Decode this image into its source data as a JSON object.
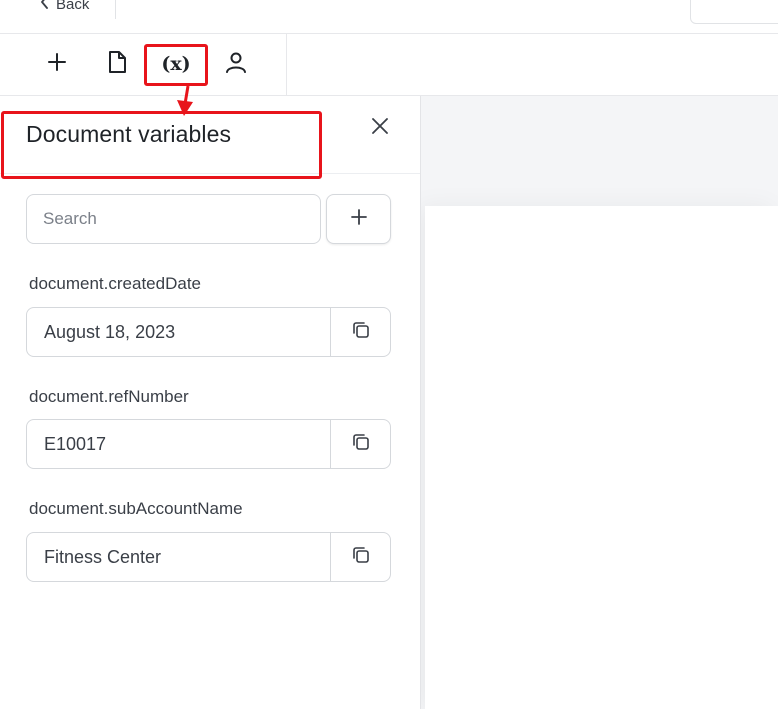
{
  "topbar": {
    "back_label": "Back",
    "back_icon": "chevron-left-icon"
  },
  "toolbar": {
    "add_icon": "plus-icon",
    "document_icon": "document-icon",
    "variables_label": "(x)",
    "user_icon": "user-icon"
  },
  "panel": {
    "title": "Document variables",
    "close_icon": "close-icon",
    "search_placeholder": "Search",
    "add_icon": "plus-icon",
    "variables": [
      {
        "name": "document.createdDate",
        "value": "August 18, 2023"
      },
      {
        "name": "document.refNumber",
        "value": "E10017"
      },
      {
        "name": "document.subAccountName",
        "value": "Fitness Center"
      }
    ],
    "copy_icon": "copy-icon"
  },
  "annotations": {
    "highlight_color": "#e8141b"
  }
}
